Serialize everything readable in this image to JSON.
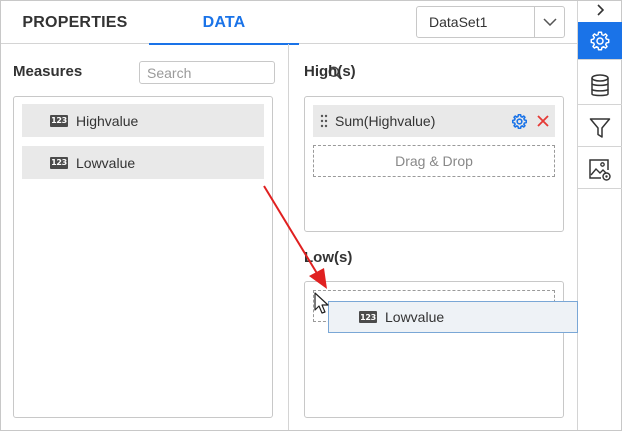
{
  "tabs": [
    {
      "label": "PROPERTIES",
      "active": false
    },
    {
      "label": "DATA",
      "active": true
    }
  ],
  "dataset": {
    "selected": "DataSet1"
  },
  "toolbar": {
    "items": [
      {
        "icon": "gear-icon",
        "active": true
      },
      {
        "icon": "database-icon",
        "active": false
      },
      {
        "icon": "filter-icon",
        "active": false
      },
      {
        "icon": "image-settings-icon",
        "active": false
      }
    ]
  },
  "measures": {
    "title": "Measures",
    "search_placeholder": "Search",
    "items": [
      {
        "icon_text": "123",
        "label": "Highvalue"
      },
      {
        "icon_text": "123",
        "label": "Lowvalue"
      }
    ]
  },
  "high": {
    "title": "High(s)",
    "fields": [
      {
        "label": "Sum(Highvalue)"
      }
    ],
    "dropzone_label": "Drag & Drop"
  },
  "low": {
    "title": "Low(s)"
  },
  "drag_ghost": {
    "icon_text": "123",
    "label": "Lowvalue"
  },
  "colors": {
    "accent": "#1a73e8",
    "annotation_arrow": "#e02020",
    "close": "#e53935"
  }
}
